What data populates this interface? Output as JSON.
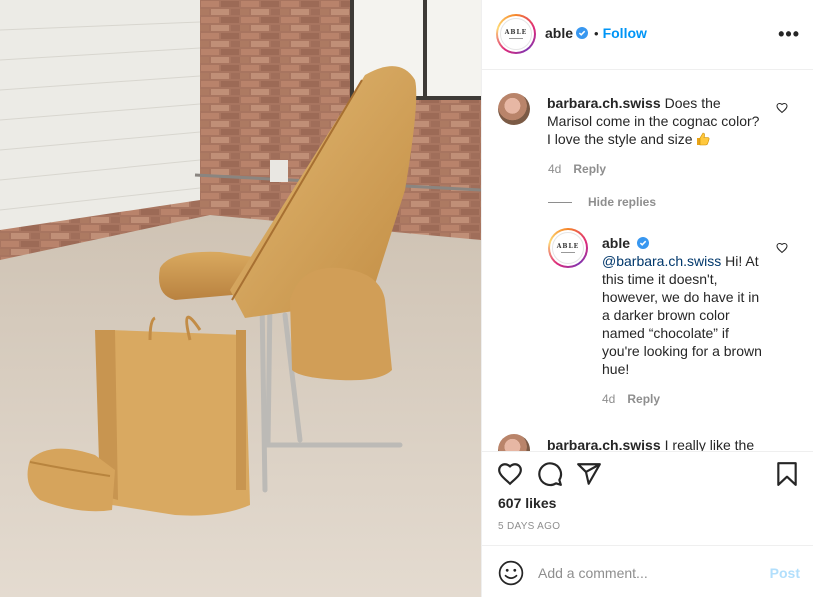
{
  "account": {
    "username": "able",
    "avatar_text": "ABLE",
    "follow_label": "Follow",
    "separator": "•",
    "more_label": "•••"
  },
  "comments": [
    {
      "username": "barbara.ch.swiss",
      "text": "Does the Marisol come in the cognac color? I love the style and size",
      "emoji": "thumbs-up",
      "age": "4d",
      "reply_label": "Reply"
    },
    {
      "username": "able",
      "mention": "@barbara.ch.swiss",
      "text": " Hi! At this time it doesn't, however, we do have it in a darker brown color named “chocolate” if you're looking for a brown hue!",
      "age": "4d",
      "reply_label": "Reply"
    },
    {
      "username": "barbara.ch.swiss",
      "text": "I really like the"
    }
  ],
  "hide_replies_label": "Hide replies",
  "post": {
    "likes": "607 likes",
    "date": "5 DAYS AGO"
  },
  "composer": {
    "placeholder": "Add a comment...",
    "post_label": "Post"
  },
  "colors": {
    "accent": "#0095f6",
    "post_disabled": "#b2dffc",
    "meta": "#8e8e8e",
    "leather": "#d6a55b"
  },
  "icons": [
    "verified-badge-icon",
    "heart-icon",
    "comment-icon",
    "share-icon",
    "bookmark-icon",
    "emoji-icon",
    "thumbs-up-icon"
  ]
}
